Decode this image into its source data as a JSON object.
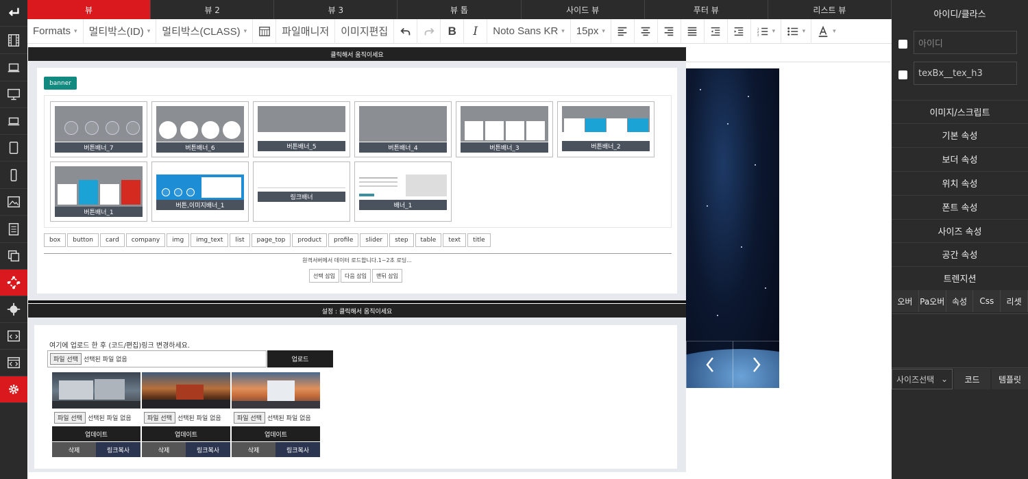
{
  "tabs": [
    "뷰",
    "뷰 2",
    "뷰 3",
    "뷰 톱",
    "사이드 뷰",
    "푸터 뷰",
    "리스트 뷰"
  ],
  "toolbar": {
    "formats": "Formats",
    "multi_id": "멀티박스(ID)",
    "multi_class": "멀티박스(CLASS)",
    "file_manager": "파일매니저",
    "image_edit": "이미지편집",
    "font": "Noto Sans KR",
    "size": "15px"
  },
  "sidebar": {
    "title": "아이디/클라스",
    "id_placeholder": "아이디",
    "class_value": "texBx__tex_h3",
    "sections": [
      "이미지/스크립트",
      "기본 속성",
      "보더 속성",
      "위치 속성",
      "폰트 속성",
      "사이즈 속성",
      "공간 속성",
      "트렌지션"
    ],
    "buttons": [
      "오버",
      "Pa오버",
      "속성",
      "Css",
      "리셋"
    ],
    "size_select": "사이즈선택",
    "code_button": "코드",
    "template_button": "템플릿"
  },
  "panel1": {
    "title": "클릭해서 움직이세요",
    "tag": "banner",
    "thumbs": [
      "버튼배너_7",
      "버튼배너_6",
      "버튼배너_5",
      "버튼배너_4",
      "버튼배너_3",
      "버튼배너_2",
      "버튼배너_1",
      "버튼,이미지배너_1",
      "링크배너",
      "배너_1"
    ],
    "categories": [
      "box",
      "button",
      "card",
      "company",
      "img",
      "img_text",
      "list",
      "page_top",
      "product",
      "profile",
      "slider",
      "step",
      "table",
      "text",
      "title"
    ],
    "load_msg": "원격서버에서 데이터 로드합니다.1~2초 로딩...",
    "insert_buttons": [
      "선택 삽입",
      "다음 삽입",
      "맨뒤 삽입"
    ]
  },
  "panel2": {
    "title": "설정 : 클릭해서 움직이세요",
    "upload_msg": "여기에 업로드 한 후 (코드/편집)링크 변경하세요.",
    "file_btn": "파일 선택",
    "file_none": "선택된 파일 없음",
    "upload_btn": "업로드",
    "cards": [
      {
        "file_btn": "파일 선택",
        "file_none": "선택된 파일 없음",
        "update": "업데이트",
        "delete": "삭제",
        "copy": "링크복사"
      },
      {
        "file_btn": "파일 선택",
        "file_none": "선택된 파일 없음",
        "update": "업데이트",
        "delete": "삭제",
        "copy": "링크복사"
      },
      {
        "file_btn": "파일 선택",
        "file_none": "선택된 파일 없음",
        "update": "업데이트",
        "delete": "삭제",
        "copy": "링크복사"
      }
    ]
  },
  "colors": {
    "accent_red": "#d9191e",
    "dark": "#2b2b2b",
    "teal": "#128a80",
    "banner_gray": "#8b8e92",
    "label_slate": "#4a525e"
  },
  "icons": {
    "rail": [
      "enter-icon",
      "film-icon",
      "laptop-icon",
      "monitor-icon",
      "laptop-small-icon",
      "tablet-icon",
      "phone-icon",
      "image-icon",
      "page-icon",
      "copy-icon",
      "move-arrows-icon",
      "crosshair-icon",
      "code-window-icon",
      "code-browser-icon",
      "gear-icon"
    ]
  }
}
